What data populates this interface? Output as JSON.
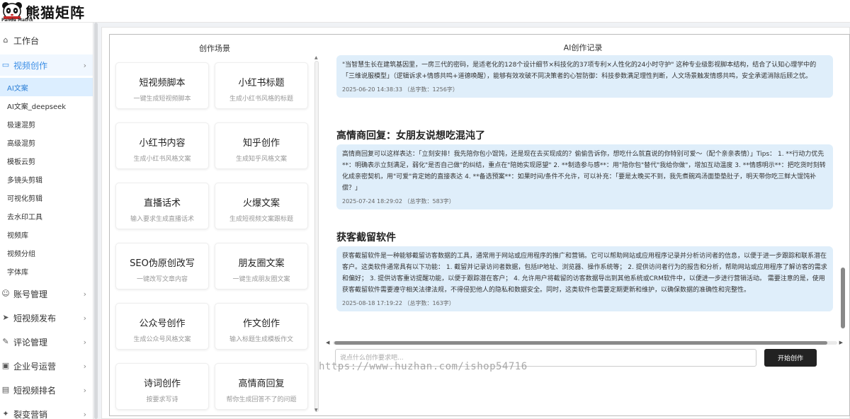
{
  "logo": {
    "text": "熊猫矩阵",
    "sub": "Panda Matrix"
  },
  "sidebar": {
    "items": [
      {
        "label": "工作台",
        "icon": "home-icon"
      },
      {
        "label": "视频创作",
        "icon": "video-icon"
      },
      {
        "label": "账号管理",
        "icon": "user-icon"
      },
      {
        "label": "短视频发布",
        "icon": "send-icon"
      },
      {
        "label": "评论管理",
        "icon": "comment-icon"
      },
      {
        "label": "企业号运营",
        "icon": "briefcase-icon"
      },
      {
        "label": "短视频排名",
        "icon": "rank-icon"
      },
      {
        "label": "裂变营销",
        "icon": "gift-icon"
      }
    ],
    "sub_items": [
      "AI文案",
      "AI文案_deepseek",
      "极速混剪",
      "高级混剪",
      "模板云剪",
      "多镜头剪辑",
      "可视化剪辑",
      "去水印工具",
      "视频库",
      "视频分组",
      "字体库"
    ]
  },
  "scenes": {
    "title": "创作场景",
    "cards": [
      {
        "title": "短视频脚本",
        "desc": "一键生成短视频脚本"
      },
      {
        "title": "小红书标题",
        "desc": "生成小红书风格的标题"
      },
      {
        "title": "小红书内容",
        "desc": "生成小红书风格文案"
      },
      {
        "title": "知乎创作",
        "desc": "生成知乎风格文案"
      },
      {
        "title": "直播话术",
        "desc": "输入要求生成直播话术"
      },
      {
        "title": "火爆文案",
        "desc": "生成短视频文案跟标题"
      },
      {
        "title": "SEO伪原创改写",
        "desc": "一键改写文章内容"
      },
      {
        "title": "朋友圈文案",
        "desc": "一键生成朋友圈文案"
      },
      {
        "title": "公众号创作",
        "desc": "生成公众号风格文案"
      },
      {
        "title": "作文创作",
        "desc": "输入标题生成模板作文"
      },
      {
        "title": "诗词创作",
        "desc": "按要求写诗"
      },
      {
        "title": "高情商回复",
        "desc": "帮你生成回答不了的问题"
      }
    ]
  },
  "records": {
    "title": "AI创作记录",
    "entries": [
      {
        "heading": "",
        "text": "\"当智慧生长在建筑基因里，一房三代的密码，是适老化的128个设计细节×科技化的37项专利×人性化的24小时守护\" 这种专业级影视脚本结构，结合了认知心理学中的「三维说服模型」（逻辑诉求+情感共鸣+道德唤醒），能够有效攻破不同决策者的心智防御：科技参数满足理性判断，人文场景触发情感共鸣，安全承诺消除后顾之忧。",
        "meta": "2025-06-20 14:38:33  （总字数：1256字）"
      },
      {
        "heading": "高情商回复：女朋友说想吃混沌了",
        "text": "高情商回复可以这样表达：「立刻安排！我先陪你包小馄饨，还是现在去买现成的？偷偷告诉你，想吃什么就直说的你特别可爱～（配个亲亲表情）」Tips： 1. **行动力优先**：明确表示立刻满足，弱化\"是否自己做\"的纠结，重点在\"陪她实现愿望\" 2. **制造参与感**：用\"陪你包\"替代\"我给你做\"，增加互动温度 3. **情感明示**：把吃货时刻转化成亲密契机，用\"可爱\"肯定她的直接表达 4. **备选预案**：如果时间/条件不允许，可以补充：「要是太晚买不到，我先煮碗鸡汤面垫垫肚子，明天带你吃三鲜大馄饨补偿？」",
        "meta": "2025-07-24 18:29:02  （总字数：583字）"
      },
      {
        "heading": "获客截留软件",
        "text": "获客截留软件是一种能够截留访客数据的工具，通常用于网站或应用程序的推广和营销。它可以帮助网站或应用程序记录并分析访问者的信息，以便于进一步跟踪和联系潜在客户。这类软件通常具有以下功能： 1. 截留并记录访问者数据，包括IP地址、浏览器、操作系统等； 2. 提供访问者行为的报告和分析，帮助网站或应用程序了解访客的需求和偏好； 3. 提供访客重访提醒功能，以便于跟踪潜在客户； 4. 允许用户将截留的访客数据导出到其他系统或CRM软件中，以便进一步进行营销活动。 需要注意的是，使用获客截留软件需要遵守相关法律法规，不得侵犯他人的隐私和数据安全。同时，这类软件也需要定期更新和维护，以确保数据的准确性和完整性。",
        "meta": "2025-08-18 17:19:22  （总字数：163字）"
      }
    ]
  },
  "prompt": {
    "placeholder": "说点什么创作要求吧...",
    "value": ""
  },
  "start_button": "开始创作",
  "watermark": "https://www.huzhan.com/ishop54716",
  "colors": {
    "accent": "#3a8ee6",
    "bubble": "#dfeefa",
    "button": "#222222"
  }
}
